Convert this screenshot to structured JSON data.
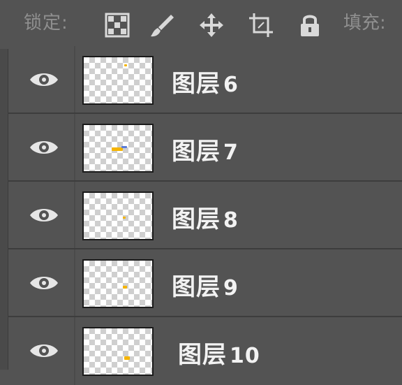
{
  "lock_bar": {
    "lock_label": "锁定",
    "colon": ":",
    "fill_label": "填充:",
    "tools": [
      "lock-transparent-pixels-icon",
      "lock-image-pixels-icon",
      "lock-position-icon",
      "lock-artboard-icon",
      "lock-all-icon"
    ]
  },
  "layers": [
    {
      "label": "图层",
      "number": "6",
      "visible": true
    },
    {
      "label": "图层",
      "number": "7",
      "visible": true
    },
    {
      "label": "图层",
      "number": "8",
      "visible": true
    },
    {
      "label": "图层",
      "number": "9",
      "visible": true
    },
    {
      "label": "图层",
      "number": "10",
      "visible": true
    }
  ],
  "colors": {
    "panel_bg": "#535353",
    "separator": "#3d3d3d",
    "text": "#f2f2f2",
    "muted_text": "#8f8f8f",
    "thumb_accent": "#f5b400"
  }
}
